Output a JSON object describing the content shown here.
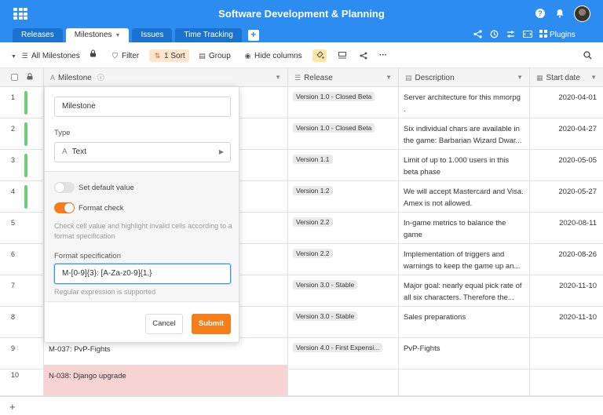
{
  "header": {
    "title": "Software Development & Planning",
    "tabs": [
      {
        "label": "Releases"
      },
      {
        "label": "Milestones"
      },
      {
        "label": "Issues"
      },
      {
        "label": "Time Tracking"
      }
    ],
    "plugins_label": "Plugins"
  },
  "toolbar": {
    "view_label": "All Milestones",
    "filter_label": "Filter",
    "sort_label": "1 Sort",
    "group_label": "Group",
    "hide_label": "Hide columns"
  },
  "columns": {
    "milestone": "Milestone",
    "release": "Release",
    "description": "Description",
    "start_date": "Start date"
  },
  "rows": [
    {
      "num": "1",
      "milestone": "",
      "release": "Version 1.0 - Closed Beta",
      "description": "Server architecture for this mmorpg .",
      "date": "2020-04-01"
    },
    {
      "num": "2",
      "milestone": "",
      "release": "Version 1.0 - Closed Beta",
      "description": "Six individual chars are available in the game: Barbarian Wizard Dwar...",
      "date": "2020-04-27"
    },
    {
      "num": "3",
      "milestone": "",
      "release": "Version 1.1",
      "description": "Limit of up to 1.000 users in this beta phase",
      "date": "2020-05-05"
    },
    {
      "num": "4",
      "milestone": "",
      "release": "Version 1.2",
      "description": "We will accept Mastercard and Visa. Amex is not allowed.",
      "date": "2020-05-27"
    },
    {
      "num": "5",
      "milestone": "",
      "release": "Version 2.2",
      "description": "In-game metrics to balance the game",
      "date": "2020-08-11"
    },
    {
      "num": "6",
      "milestone": "",
      "release": "Version 2.2",
      "description": "Implementation of triggers and warnings to keep the game up an...",
      "date": "2020-08-26"
    },
    {
      "num": "7",
      "milestone": "",
      "release": "Version 3.0 - Stable",
      "description": "Major goal: nearly equal pick rate of all six characters. Therefore the...",
      "date": "2020-11-10"
    },
    {
      "num": "8",
      "milestone": "",
      "release": "Version 3.0 - Stable",
      "description": "Sales preparations",
      "date": "2020-11-10"
    },
    {
      "num": "9",
      "milestone": "M-037: PvP-Fights",
      "release": "Version 4.0 - First Expensi...",
      "description": "PvP-Fights",
      "date": ""
    },
    {
      "num": "10",
      "milestone": "N-038: Django upgrade",
      "release": "",
      "description": "",
      "date": ""
    }
  ],
  "popup": {
    "name_value": "Milestone",
    "type_label": "Type",
    "type_value": "Text",
    "default_label": "Set default value",
    "format_check_label": "Format check",
    "help_text": "Check cell value and highlight invalid cells according to a format specification",
    "spec_label": "Format specification",
    "spec_value": "M-[0-9]{3}: [A-Za-z0-9]{1,}",
    "regex_note": "Regular expression is supported",
    "cancel_label": "Cancel",
    "submit_label": "Submit"
  },
  "colors": {
    "brand": "#2d8cf0",
    "accent": "#f57e1a",
    "invalid": "#f7d3d3",
    "row_marker": "#6bcf7a"
  }
}
